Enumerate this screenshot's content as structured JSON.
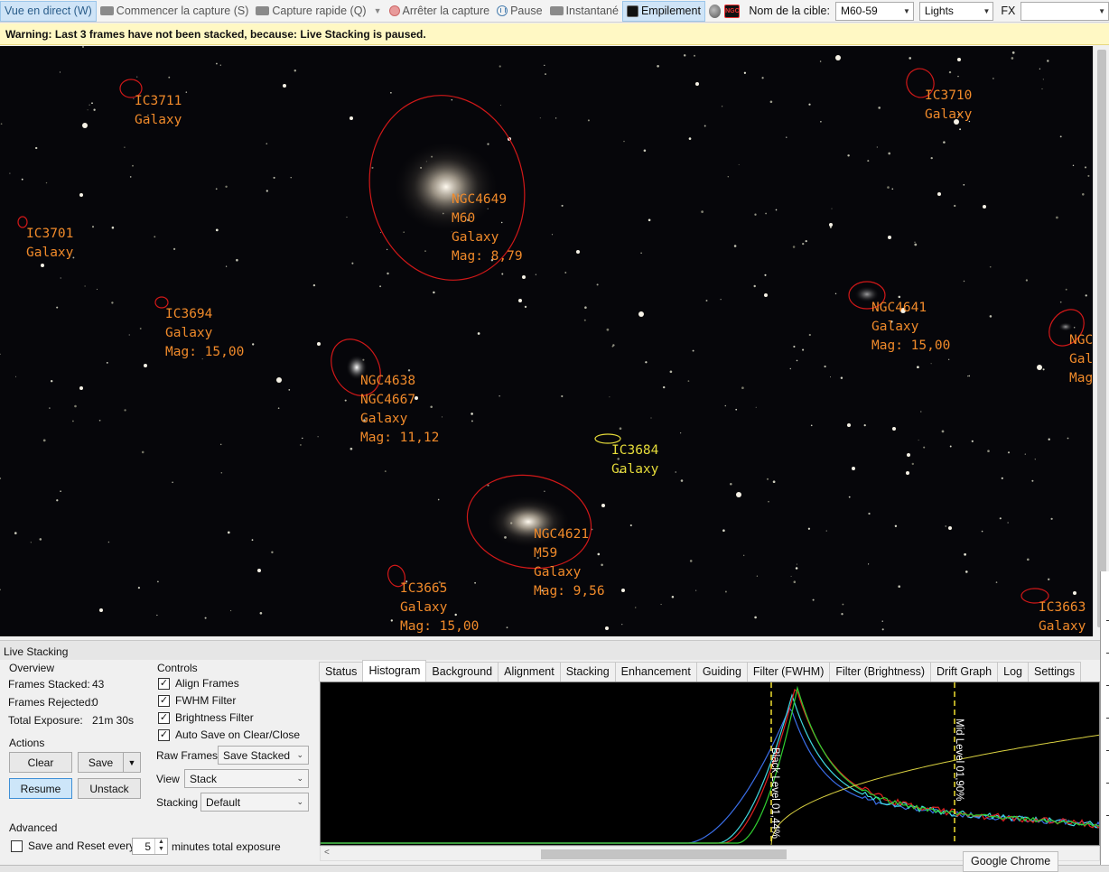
{
  "toolbar": {
    "live_view": "Vue en direct (W)",
    "start_capture": "Commencer la capture (S)",
    "quick_capture": "Capture rapide (Q)",
    "stop_capture": "Arrêter la capture",
    "pause": "Pause",
    "snapshot": "Instantané",
    "stacking": "Empilement",
    "target_label": "Nom de la cible:",
    "target_value": "M60-59",
    "frame_type": "Lights",
    "fx_label": "FX",
    "fx_value": ""
  },
  "warning": "Warning: Last 3 frames have not been stacked, because: Live Stacking is paused.",
  "annotations": [
    {
      "id": "ic3711",
      "text": "IC3711\nGalaxy",
      "color": "orange"
    },
    {
      "id": "ic3710",
      "text": "IC3710\nGalaxy",
      "color": "orange"
    },
    {
      "id": "ic3701",
      "text": "IC3701\nGalaxy",
      "color": "orange"
    },
    {
      "id": "ngc4649",
      "text": "NGC4649\nM60\nGalaxy\nMag: 8,79",
      "color": "orange"
    },
    {
      "id": "ic3694",
      "text": "IC3694\nGalaxy\nMag: 15,00",
      "color": "orange"
    },
    {
      "id": "ngc4641",
      "text": "NGC4641\nGalaxy\nMag: 15,00",
      "color": "orange"
    },
    {
      "id": "ngc_edge",
      "text": "NGC\nGal\nMag",
      "color": "orange"
    },
    {
      "id": "ngc4638",
      "text": "NGC4638\nNGC4667\nGalaxy\nMag: 11,12",
      "color": "orange"
    },
    {
      "id": "ic3684",
      "text": "IC3684\nGalaxy",
      "color": "yellow"
    },
    {
      "id": "ngc4621",
      "text": "NGC4621\nM59\nGalaxy\nMag: 9,56",
      "color": "orange"
    },
    {
      "id": "ic3665",
      "text": "IC3665\nGalaxy\nMag: 15,00",
      "color": "orange"
    },
    {
      "id": "ic3663",
      "text": "IC3663\nGalaxy",
      "color": "orange"
    }
  ],
  "live_stacking": {
    "header": "Live Stacking",
    "overview": {
      "title": "Overview",
      "frames_stacked_label": "Frames Stacked:",
      "frames_stacked": "43",
      "frames_rejected_label": "Frames Rejected:",
      "frames_rejected": "0",
      "total_exposure_label": "Total Exposure:",
      "total_exposure": "21m 30s"
    },
    "actions": {
      "title": "Actions",
      "clear": "Clear",
      "save": "Save",
      "resume": "Resume",
      "unstack": "Unstack"
    },
    "advanced": {
      "title": "Advanced",
      "save_reset_label": "Save and Reset every",
      "minutes_value": "5",
      "minutes_suffix": "minutes total exposure"
    },
    "controls": {
      "title": "Controls",
      "align_frames": "Align Frames",
      "fwhm_filter": "FWHM Filter",
      "brightness_filter": "Brightness Filter",
      "auto_save": "Auto Save on Clear/Close",
      "raw_frames_label": "Raw Frames",
      "raw_frames_value": "Save Stacked",
      "view_label": "View",
      "view_value": "Stack",
      "stacking_label": "Stacking",
      "stacking_value": "Default"
    },
    "tabs": [
      "Status",
      "Histogram",
      "Background",
      "Alignment",
      "Stacking",
      "Enhancement",
      "Guiding",
      "Filter (FWHM)",
      "Filter (Brightness)",
      "Drift Graph",
      "Log",
      "Settings"
    ],
    "selected_tab": "Histogram",
    "histogram": {
      "black_level_label": "Black Level 01,44%",
      "mid_level_label": "Mid Level 01,90%",
      "colors": {
        "red": "#e02020",
        "green": "#30d030",
        "blue": "#3a6ee8",
        "cyan": "#40d8e0",
        "curve": "#d8d040"
      }
    }
  },
  "tooltip": "Google Chrome"
}
